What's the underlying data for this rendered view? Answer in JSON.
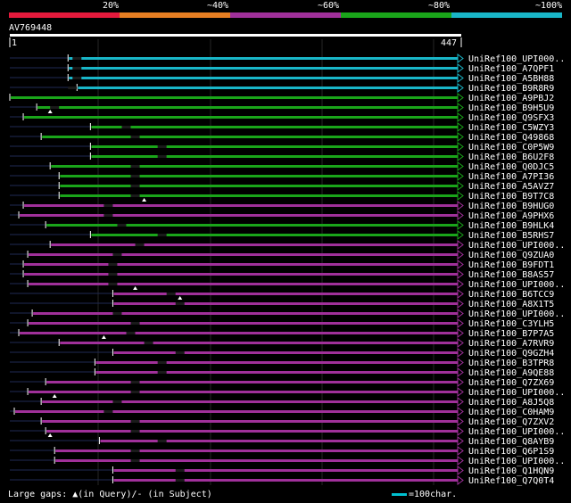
{
  "legend": [
    {
      "label": "20%",
      "color": "#e41a3c"
    },
    {
      "label": "~40%",
      "color": "#e67e22"
    },
    {
      "label": "~60%",
      "color": "#a0309a"
    },
    {
      "label": "~80%",
      "color": "#1aa51a"
    },
    {
      "label": "~100%",
      "color": "#19b6c8"
    }
  ],
  "query": {
    "id": "AV769448",
    "start": "1",
    "end": "447",
    "length": 447
  },
  "footer": {
    "gaps_note": "Large gaps: ▲(in Query)/- (in Subject)",
    "scale_note": "=100char."
  },
  "hits": [
    {
      "name": "UniRef100_UPI000..",
      "color": "#19b6c8",
      "start": 0.13,
      "qmarks": [],
      "smarks": [
        0.14
      ]
    },
    {
      "name": "UniRef100_A7QPF1",
      "color": "#19b6c8",
      "start": 0.13,
      "qmarks": [],
      "smarks": [
        0.14
      ]
    },
    {
      "name": "UniRef100_A5BH88",
      "color": "#19b6c8",
      "start": 0.13,
      "qmarks": [],
      "smarks": [
        0.14
      ]
    },
    {
      "name": "UniRef100_B9R8R9",
      "color": "#19b6c8",
      "start": 0.15,
      "qmarks": [],
      "smarks": [
        0.13
      ]
    },
    {
      "name": "UniRef100_A9PBJ2",
      "color": "#1aa51a",
      "start": 0.0,
      "qmarks": [],
      "smarks": []
    },
    {
      "name": "UniRef100_B9H5U9",
      "color": "#1aa51a",
      "start": 0.06,
      "qmarks": [
        0.09
      ],
      "smarks": [
        0.09
      ]
    },
    {
      "name": "UniRef100_Q9SFX3",
      "color": "#1aa51a",
      "start": 0.03,
      "qmarks": [],
      "smarks": []
    },
    {
      "name": "UniRef100_C5WZY3",
      "color": "#1aa51a",
      "start": 0.18,
      "qmarks": [],
      "smarks": [
        0.25
      ]
    },
    {
      "name": "UniRef100_Q49868",
      "color": "#1aa51a",
      "start": 0.07,
      "qmarks": [],
      "smarks": [
        0.27
      ]
    },
    {
      "name": "UniRef100_C0P5W9",
      "color": "#1aa51a",
      "start": 0.18,
      "qmarks": [],
      "smarks": [
        0.33
      ]
    },
    {
      "name": "UniRef100_B6U2F8",
      "color": "#1aa51a",
      "start": 0.18,
      "qmarks": [],
      "smarks": [
        0.33
      ]
    },
    {
      "name": "UniRef100_Q0DJC5",
      "color": "#1aa51a",
      "start": 0.09,
      "qmarks": [],
      "smarks": [
        0.27
      ]
    },
    {
      "name": "UniRef100_A7PI36",
      "color": "#1aa51a",
      "start": 0.11,
      "qmarks": [],
      "smarks": [
        0.27
      ]
    },
    {
      "name": "UniRef100_A5AVZ7",
      "color": "#1aa51a",
      "start": 0.11,
      "qmarks": [],
      "smarks": [
        0.27
      ]
    },
    {
      "name": "UniRef100_B9T7C8",
      "color": "#1aa51a",
      "start": 0.11,
      "qmarks": [
        0.3
      ],
      "smarks": [
        0.27
      ]
    },
    {
      "name": "UniRef100_B9HUG0",
      "color": "#a0309a",
      "start": 0.03,
      "qmarks": [],
      "smarks": [
        0.21
      ]
    },
    {
      "name": "UniRef100_A9PHX6",
      "color": "#a0309a",
      "start": 0.02,
      "qmarks": [],
      "smarks": [
        0.21
      ]
    },
    {
      "name": "UniRef100_B9HLK4",
      "color": "#1aa51a",
      "start": 0.08,
      "qmarks": [],
      "smarks": [
        0.24
      ]
    },
    {
      "name": "UniRef100_B5RHS7",
      "color": "#1aa51a",
      "start": 0.18,
      "qmarks": [],
      "smarks": [
        0.33
      ]
    },
    {
      "name": "UniRef100_UPI000..",
      "color": "#a0309a",
      "start": 0.09,
      "qmarks": [],
      "smarks": [
        0.28
      ]
    },
    {
      "name": "UniRef100_Q9ZUA0",
      "color": "#a0309a",
      "start": 0.04,
      "qmarks": [],
      "smarks": [
        0.23
      ]
    },
    {
      "name": "UniRef100_B9FDT1",
      "color": "#a0309a",
      "start": 0.03,
      "qmarks": [],
      "smarks": [
        0.22
      ]
    },
    {
      "name": "UniRef100_B8AS57",
      "color": "#a0309a",
      "start": 0.03,
      "qmarks": [],
      "smarks": [
        0.22
      ]
    },
    {
      "name": "UniRef100_UPI000..",
      "color": "#a0309a",
      "start": 0.04,
      "qmarks": [
        0.28
      ],
      "smarks": [
        0.22
      ]
    },
    {
      "name": "UniRef100_B6TCC9",
      "color": "#a0309a",
      "start": 0.23,
      "qmarks": [
        0.38
      ],
      "smarks": [
        0.35
      ]
    },
    {
      "name": "UniRef100_A8X1T5",
      "color": "#a0309a",
      "start": 0.23,
      "qmarks": [],
      "smarks": [
        0.37
      ]
    },
    {
      "name": "UniRef100_UPI000..",
      "color": "#a0309a",
      "start": 0.05,
      "qmarks": [],
      "smarks": [
        0.23
      ]
    },
    {
      "name": "UniRef100_C3YLH5",
      "color": "#a0309a",
      "start": 0.04,
      "qmarks": [],
      "smarks": [
        0.27
      ]
    },
    {
      "name": "UniRef100_B7P7A5",
      "color": "#a0309a",
      "start": 0.02,
      "qmarks": [
        0.21
      ],
      "smarks": [
        0.26
      ]
    },
    {
      "name": "UniRef100_A7RVR9",
      "color": "#a0309a",
      "start": 0.11,
      "qmarks": [],
      "smarks": [
        0.3
      ]
    },
    {
      "name": "UniRef100_Q9GZH4",
      "color": "#a0309a",
      "start": 0.23,
      "qmarks": [],
      "smarks": [
        0.37
      ]
    },
    {
      "name": "UniRef100_B3TPR8",
      "color": "#a0309a",
      "start": 0.19,
      "qmarks": [],
      "smarks": [
        0.33
      ]
    },
    {
      "name": "UniRef100_A9QE88",
      "color": "#a0309a",
      "start": 0.19,
      "qmarks": [],
      "smarks": [
        0.33
      ]
    },
    {
      "name": "UniRef100_Q7ZX69",
      "color": "#a0309a",
      "start": 0.08,
      "qmarks": [],
      "smarks": [
        0.27
      ]
    },
    {
      "name": "UniRef100_UPI000..",
      "color": "#a0309a",
      "start": 0.04,
      "qmarks": [
        0.1
      ],
      "smarks": [
        0.27
      ]
    },
    {
      "name": "UniRef100_A8J5Q8",
      "color": "#a0309a",
      "start": 0.07,
      "qmarks": [],
      "smarks": [
        0.23
      ]
    },
    {
      "name": "UniRef100_C0HAM9",
      "color": "#a0309a",
      "start": 0.01,
      "qmarks": [],
      "smarks": [
        0.21
      ]
    },
    {
      "name": "UniRef100_Q7ZXV2",
      "color": "#a0309a",
      "start": 0.07,
      "qmarks": [],
      "smarks": [
        0.27
      ]
    },
    {
      "name": "UniRef100_UPI000..",
      "color": "#a0309a",
      "start": 0.08,
      "qmarks": [
        0.09
      ],
      "smarks": [
        0.27
      ]
    },
    {
      "name": "UniRef100_Q8AYB9",
      "color": "#a0309a",
      "start": 0.2,
      "qmarks": [],
      "smarks": [
        0.33
      ]
    },
    {
      "name": "UniRef100_Q6P1S9",
      "color": "#a0309a",
      "start": 0.1,
      "qmarks": [],
      "smarks": [
        0.27
      ]
    },
    {
      "name": "UniRef100_UPI000..",
      "color": "#a0309a",
      "start": 0.1,
      "qmarks": [],
      "smarks": [
        0.27
      ]
    },
    {
      "name": "UniRef100_Q1HQN9",
      "color": "#a0309a",
      "start": 0.23,
      "qmarks": [],
      "smarks": [
        0.37
      ]
    },
    {
      "name": "UniRef100_Q7Q0T4",
      "color": "#a0309a",
      "start": 0.23,
      "qmarks": [],
      "smarks": [
        0.37
      ]
    }
  ]
}
